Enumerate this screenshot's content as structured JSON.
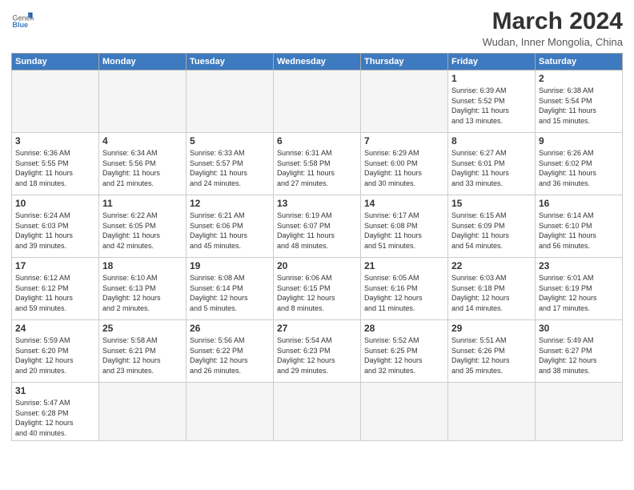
{
  "logo": {
    "general": "General",
    "blue": "Blue"
  },
  "header": {
    "month_year": "March 2024",
    "location": "Wudan, Inner Mongolia, China"
  },
  "weekdays": [
    "Sunday",
    "Monday",
    "Tuesday",
    "Wednesday",
    "Thursday",
    "Friday",
    "Saturday"
  ],
  "weeks": [
    [
      {
        "day": "",
        "info": ""
      },
      {
        "day": "",
        "info": ""
      },
      {
        "day": "",
        "info": ""
      },
      {
        "day": "",
        "info": ""
      },
      {
        "day": "",
        "info": ""
      },
      {
        "day": "1",
        "info": "Sunrise: 6:39 AM\nSunset: 5:52 PM\nDaylight: 11 hours\nand 13 minutes."
      },
      {
        "day": "2",
        "info": "Sunrise: 6:38 AM\nSunset: 5:54 PM\nDaylight: 11 hours\nand 15 minutes."
      }
    ],
    [
      {
        "day": "3",
        "info": "Sunrise: 6:36 AM\nSunset: 5:55 PM\nDaylight: 11 hours\nand 18 minutes."
      },
      {
        "day": "4",
        "info": "Sunrise: 6:34 AM\nSunset: 5:56 PM\nDaylight: 11 hours\nand 21 minutes."
      },
      {
        "day": "5",
        "info": "Sunrise: 6:33 AM\nSunset: 5:57 PM\nDaylight: 11 hours\nand 24 minutes."
      },
      {
        "day": "6",
        "info": "Sunrise: 6:31 AM\nSunset: 5:58 PM\nDaylight: 11 hours\nand 27 minutes."
      },
      {
        "day": "7",
        "info": "Sunrise: 6:29 AM\nSunset: 6:00 PM\nDaylight: 11 hours\nand 30 minutes."
      },
      {
        "day": "8",
        "info": "Sunrise: 6:27 AM\nSunset: 6:01 PM\nDaylight: 11 hours\nand 33 minutes."
      },
      {
        "day": "9",
        "info": "Sunrise: 6:26 AM\nSunset: 6:02 PM\nDaylight: 11 hours\nand 36 minutes."
      }
    ],
    [
      {
        "day": "10",
        "info": "Sunrise: 6:24 AM\nSunset: 6:03 PM\nDaylight: 11 hours\nand 39 minutes."
      },
      {
        "day": "11",
        "info": "Sunrise: 6:22 AM\nSunset: 6:05 PM\nDaylight: 11 hours\nand 42 minutes."
      },
      {
        "day": "12",
        "info": "Sunrise: 6:21 AM\nSunset: 6:06 PM\nDaylight: 11 hours\nand 45 minutes."
      },
      {
        "day": "13",
        "info": "Sunrise: 6:19 AM\nSunset: 6:07 PM\nDaylight: 11 hours\nand 48 minutes."
      },
      {
        "day": "14",
        "info": "Sunrise: 6:17 AM\nSunset: 6:08 PM\nDaylight: 11 hours\nand 51 minutes."
      },
      {
        "day": "15",
        "info": "Sunrise: 6:15 AM\nSunset: 6:09 PM\nDaylight: 11 hours\nand 54 minutes."
      },
      {
        "day": "16",
        "info": "Sunrise: 6:14 AM\nSunset: 6:10 PM\nDaylight: 11 hours\nand 56 minutes."
      }
    ],
    [
      {
        "day": "17",
        "info": "Sunrise: 6:12 AM\nSunset: 6:12 PM\nDaylight: 11 hours\nand 59 minutes."
      },
      {
        "day": "18",
        "info": "Sunrise: 6:10 AM\nSunset: 6:13 PM\nDaylight: 12 hours\nand 2 minutes."
      },
      {
        "day": "19",
        "info": "Sunrise: 6:08 AM\nSunset: 6:14 PM\nDaylight: 12 hours\nand 5 minutes."
      },
      {
        "day": "20",
        "info": "Sunrise: 6:06 AM\nSunset: 6:15 PM\nDaylight: 12 hours\nand 8 minutes."
      },
      {
        "day": "21",
        "info": "Sunrise: 6:05 AM\nSunset: 6:16 PM\nDaylight: 12 hours\nand 11 minutes."
      },
      {
        "day": "22",
        "info": "Sunrise: 6:03 AM\nSunset: 6:18 PM\nDaylight: 12 hours\nand 14 minutes."
      },
      {
        "day": "23",
        "info": "Sunrise: 6:01 AM\nSunset: 6:19 PM\nDaylight: 12 hours\nand 17 minutes."
      }
    ],
    [
      {
        "day": "24",
        "info": "Sunrise: 5:59 AM\nSunset: 6:20 PM\nDaylight: 12 hours\nand 20 minutes."
      },
      {
        "day": "25",
        "info": "Sunrise: 5:58 AM\nSunset: 6:21 PM\nDaylight: 12 hours\nand 23 minutes."
      },
      {
        "day": "26",
        "info": "Sunrise: 5:56 AM\nSunset: 6:22 PM\nDaylight: 12 hours\nand 26 minutes."
      },
      {
        "day": "27",
        "info": "Sunrise: 5:54 AM\nSunset: 6:23 PM\nDaylight: 12 hours\nand 29 minutes."
      },
      {
        "day": "28",
        "info": "Sunrise: 5:52 AM\nSunset: 6:25 PM\nDaylight: 12 hours\nand 32 minutes."
      },
      {
        "day": "29",
        "info": "Sunrise: 5:51 AM\nSunset: 6:26 PM\nDaylight: 12 hours\nand 35 minutes."
      },
      {
        "day": "30",
        "info": "Sunrise: 5:49 AM\nSunset: 6:27 PM\nDaylight: 12 hours\nand 38 minutes."
      }
    ],
    [
      {
        "day": "31",
        "info": "Sunrise: 5:47 AM\nSunset: 6:28 PM\nDaylight: 12 hours\nand 40 minutes."
      },
      {
        "day": "",
        "info": ""
      },
      {
        "day": "",
        "info": ""
      },
      {
        "day": "",
        "info": ""
      },
      {
        "day": "",
        "info": ""
      },
      {
        "day": "",
        "info": ""
      },
      {
        "day": "",
        "info": ""
      }
    ]
  ]
}
